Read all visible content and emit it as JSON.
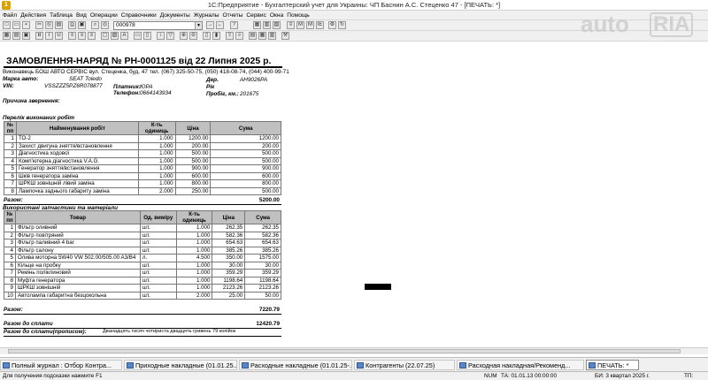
{
  "window": {
    "title": "1С:Предприятие - Бухгалтерский учет для Украины: ЧП Баснин А.С. Стеценко 47 - [ПЕЧАТЬ: *]"
  },
  "menu": [
    "Файл",
    "Действия",
    "Таблица",
    "Вид",
    "Операции",
    "Справочники",
    "Документы",
    "Журналы",
    "Отчеты",
    "Сервис",
    "Окна",
    "Помощь"
  ],
  "toolbar": {
    "combo_value": "000978",
    "font_m": "M",
    "font_m2": "M",
    "font_ie": "IE"
  },
  "document": {
    "heading": "ЗАМОВЛЕННЯ-НАРЯД  № РН-0001125  від 22 Липня 2025 р.",
    "executor": "Виконавець БОШ АВТО СЕРВІС вул. Стеценка, буд. 47 тел. (067) 325-50-75, (050) 418-08-74, (044) 400-99-71",
    "car_brand_label": "Марка авто:",
    "car_brand": "SEAT Toledo",
    "reg_label": "Дер.",
    "reg": "AH9026PA",
    "vin_label": "VIN:",
    "vin": "VSSZZZ5PZ6R078877",
    "payer_label": "Платник:",
    "payer": "ЮРА",
    "year_label": "Рік",
    "year": "",
    "phone_label": "Телефон:",
    "phone": "0664143934",
    "mileage_label": "Пробіг, км.:",
    "mileage": "201675",
    "reason_label": "Причина звернення:",
    "works_title": "Перелік виконаних робіт",
    "works_headers": [
      "№ пп",
      "Найменування робіт",
      "К-ть одиниць",
      "Ціна",
      "Сума"
    ],
    "works": [
      [
        "1",
        "ТО-2",
        "1.000",
        "1200.00",
        "1200.00"
      ],
      [
        "2",
        "Захист двигуна зняття/встановлення",
        "1.000",
        "200.00",
        "200.00"
      ],
      [
        "3",
        "Діагностика ходової",
        "1.000",
        "500.00",
        "500.00"
      ],
      [
        "4",
        "Комп'ютерна діагностика V.A.G.",
        "1.000",
        "500.00",
        "500.00"
      ],
      [
        "5",
        "Генератор зняття/встановлення",
        "1.000",
        "900.00",
        "900.00"
      ],
      [
        "6",
        "Шків генератора заміна",
        "1.000",
        "600.00",
        "600.00"
      ],
      [
        "7",
        "ШРКШ зовнішній лівий заміна",
        "1.000",
        "800.00",
        "800.00"
      ],
      [
        "8",
        "Лампочка заднього габариту заміна",
        "2.000",
        "250.00",
        "500.00"
      ]
    ],
    "works_total_label": "Разом:",
    "works_total": "5200.00",
    "parts_title": "Використані запчастини та матеріали",
    "parts_headers": [
      "№ пп",
      "Товар",
      "Од. виміру",
      "К-ть одиниць",
      "Ціна",
      "Сума"
    ],
    "parts": [
      [
        "1",
        "Фільтр оливний",
        "шт.",
        "1.000",
        "262.35",
        "262.35"
      ],
      [
        "2",
        "Фільтр повітряний",
        "шт.",
        "1.000",
        "582.36",
        "582.36"
      ],
      [
        "3",
        "Фільтр паливний 4 bar",
        "шт.",
        "1.000",
        "654.63",
        "654.63"
      ],
      [
        "4",
        "Фільтр салону",
        "шт.",
        "1.000",
        "385.26",
        "385.26"
      ],
      [
        "5",
        "Олива моторна 5W40 VW 502.00/505.00 A3/B4",
        "л.",
        "4.500",
        "350.00",
        "1575.00"
      ],
      [
        "6",
        "Кільце на пробку",
        "шт.",
        "1.000",
        "30.00",
        "30.00"
      ],
      [
        "7",
        "Ремінь поліклиновий",
        "шт.",
        "1.000",
        "359.29",
        "359.29"
      ],
      [
        "8",
        "Муфта генератора",
        "шт.",
        "1.000",
        "1198.64",
        "1198.64"
      ],
      [
        "9",
        "ШРКШ зовнішній",
        "шт.",
        "1.000",
        "2123.26",
        "2123.26"
      ],
      [
        "10",
        "Автолампа габаритна безцокольна",
        "шт.",
        "2.000",
        "25.00",
        "50.00"
      ]
    ],
    "parts_total_label": "Разом:",
    "parts_total": "7220.79",
    "pay_label": "Разом до сплати",
    "pay_total": "12420.79",
    "pay_words_label": "Разом до сплати(прописом):",
    "pay_words": "Дванадцять тисяч чотириста двадцять гривень 79 копійок"
  },
  "taskbar": [
    {
      "label": "Полный журнал : Отбор Контра...",
      "active": false
    },
    {
      "label": "Приходные накладные (01.01.25...",
      "active": false
    },
    {
      "label": "Расходные накладные (01.01.25-...",
      "active": false
    },
    {
      "label": "Контрагенты (22.07.25)",
      "active": false
    },
    {
      "label": "Расходная накладная/Рекоменд...",
      "active": false
    },
    {
      "label": "ПЕЧАТЬ:  *",
      "active": true
    }
  ],
  "status": {
    "hint": "Для получения подсказки нажмите F1",
    "num": "NUM",
    "ta": "ТА: 01.01.13  00:00:00",
    "bi": "БИ: 3 квартал 2025 г.",
    "tp": "ТП:"
  },
  "watermark": {
    "text1": "auto",
    "text2": "RIA"
  }
}
